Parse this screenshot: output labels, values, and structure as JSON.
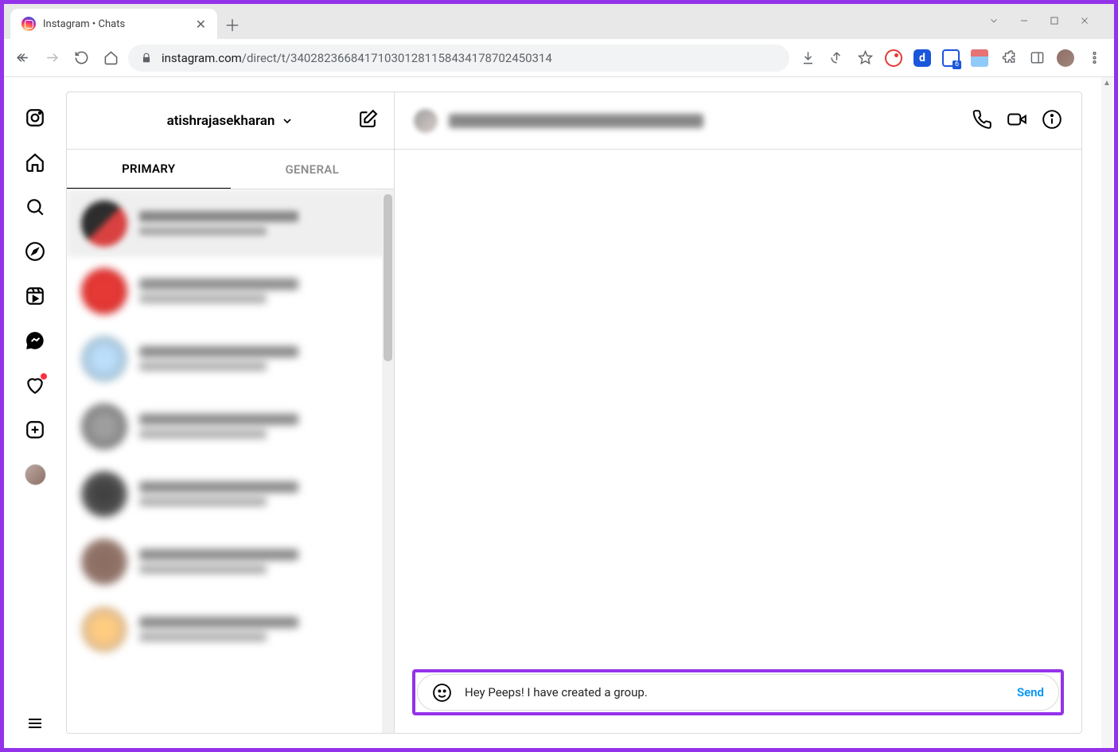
{
  "browser": {
    "tab_title": "Instagram • Chats",
    "url_host": "instagram.com",
    "url_path": "/direct/t/340282366841710301281158434178702450314",
    "ext_badge": "6"
  },
  "rail": {},
  "inbox": {
    "username": "atishrajasekharan",
    "tabs": {
      "primary": "PRIMARY",
      "general": "GENERAL"
    }
  },
  "composer": {
    "value": "Hey Peeps! I have created a group.",
    "send_label": "Send"
  }
}
